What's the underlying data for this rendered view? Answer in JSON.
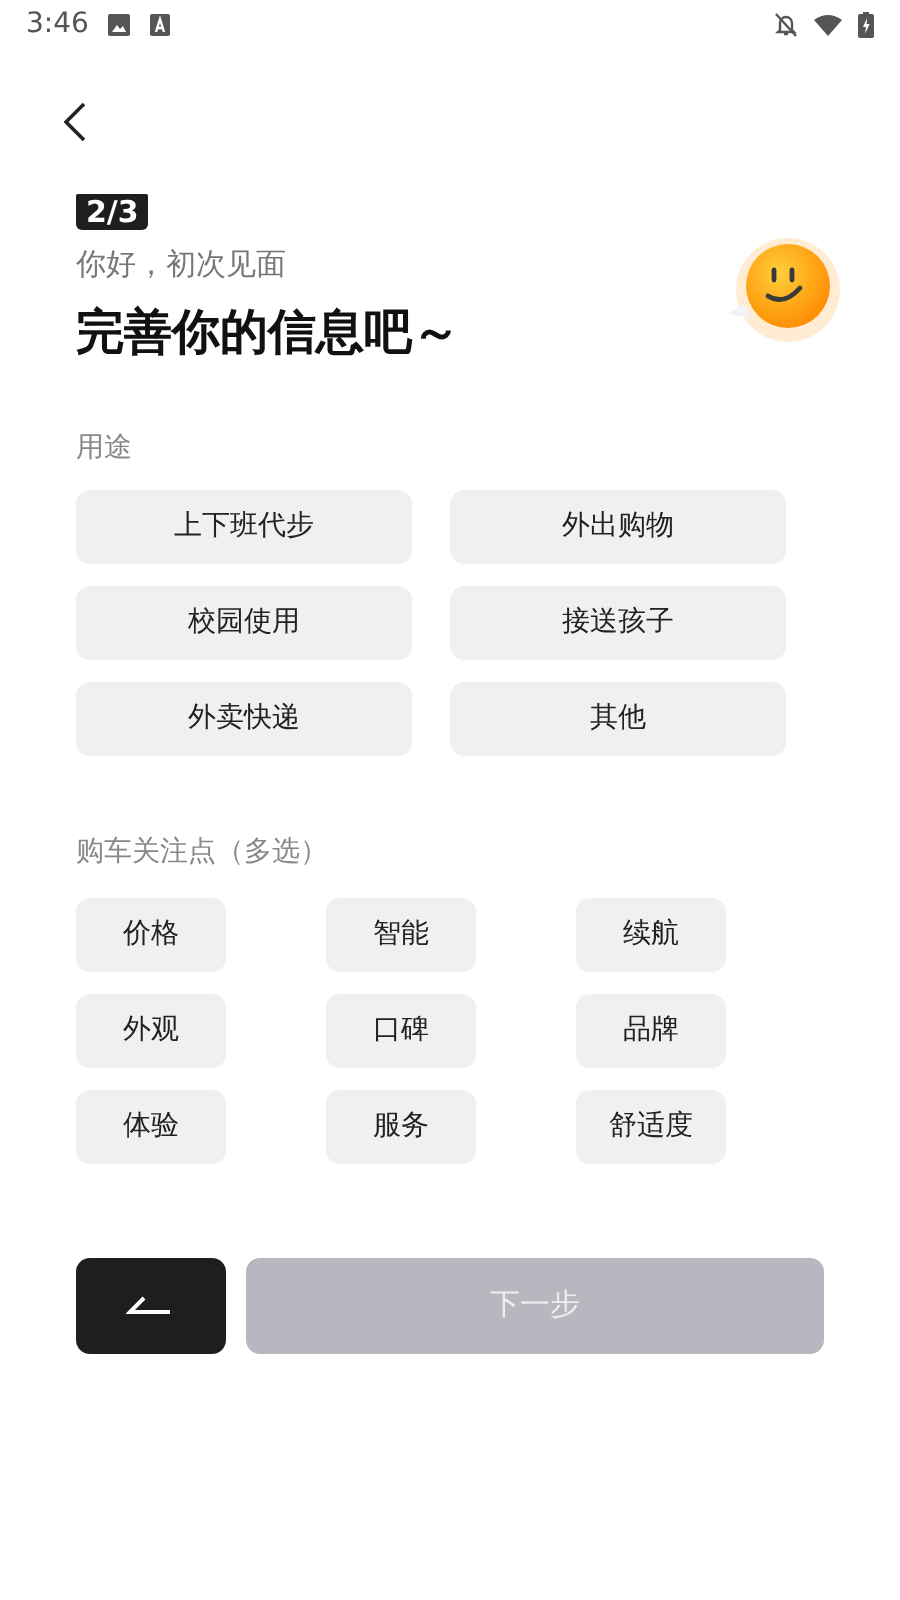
{
  "status_bar": {
    "time": "3:46"
  },
  "step_badge": "2/3",
  "greeting": "你好，初次见面",
  "title": "完善你的信息吧～",
  "usage": {
    "label": "用途",
    "options": [
      {
        "label": "上下班代步",
        "selected": false
      },
      {
        "label": "外出购物",
        "selected": false
      },
      {
        "label": "校园使用",
        "selected": false
      },
      {
        "label": "接送孩子",
        "selected": false
      },
      {
        "label": "外卖快递",
        "selected": false
      },
      {
        "label": "其他",
        "selected": false
      }
    ]
  },
  "concerns": {
    "label": "购车关注点（多选）",
    "options": [
      {
        "label": "价格",
        "selected": false
      },
      {
        "label": "智能",
        "selected": false
      },
      {
        "label": "续航",
        "selected": false
      },
      {
        "label": "外观",
        "selected": false
      },
      {
        "label": "口碑",
        "selected": false
      },
      {
        "label": "品牌",
        "selected": false
      },
      {
        "label": "体验",
        "selected": false
      },
      {
        "label": "服务",
        "selected": false
      },
      {
        "label": "舒适度",
        "selected": false
      }
    ]
  },
  "next_button": {
    "label": "下一步",
    "disabled": true
  }
}
